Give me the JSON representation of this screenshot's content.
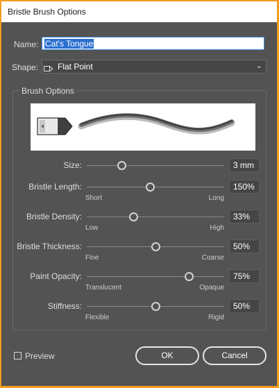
{
  "window": {
    "title": "Bristle Brush Options"
  },
  "name_field": {
    "label": "Name:",
    "value": "Cat's Tongue"
  },
  "shape_field": {
    "label": "Shape:",
    "value": "Flat Point",
    "icon": "flat-point-brush-icon"
  },
  "brush_options": {
    "title": "Brush Options",
    "sliders": [
      {
        "label": "Size:",
        "value": "3 mm",
        "position": 0.25,
        "min_label": "",
        "max_label": ""
      },
      {
        "label": "Bristle Length:",
        "value": "150%",
        "position": 0.46,
        "min_label": "Short",
        "max_label": "Long"
      },
      {
        "label": "Bristle Density:",
        "value": "33%",
        "position": 0.34,
        "min_label": "Low",
        "max_label": "High"
      },
      {
        "label": "Bristle Thickness:",
        "value": "50%",
        "position": 0.5,
        "min_label": "Fine",
        "max_label": "Coarse"
      },
      {
        "label": "Paint Opacity:",
        "value": "75%",
        "position": 0.74,
        "min_label": "Translucent",
        "max_label": "Opaque"
      },
      {
        "label": "Stiffness:",
        "value": "50%",
        "position": 0.5,
        "min_label": "Flexible",
        "max_label": "Rigid"
      }
    ]
  },
  "preview_checkbox": {
    "label": "Preview",
    "checked": false
  },
  "buttons": {
    "ok": "OK",
    "cancel": "Cancel"
  },
  "colors": {
    "accent": "#2b6fcf",
    "panel": "#535353",
    "frame": "#f39c1f"
  }
}
